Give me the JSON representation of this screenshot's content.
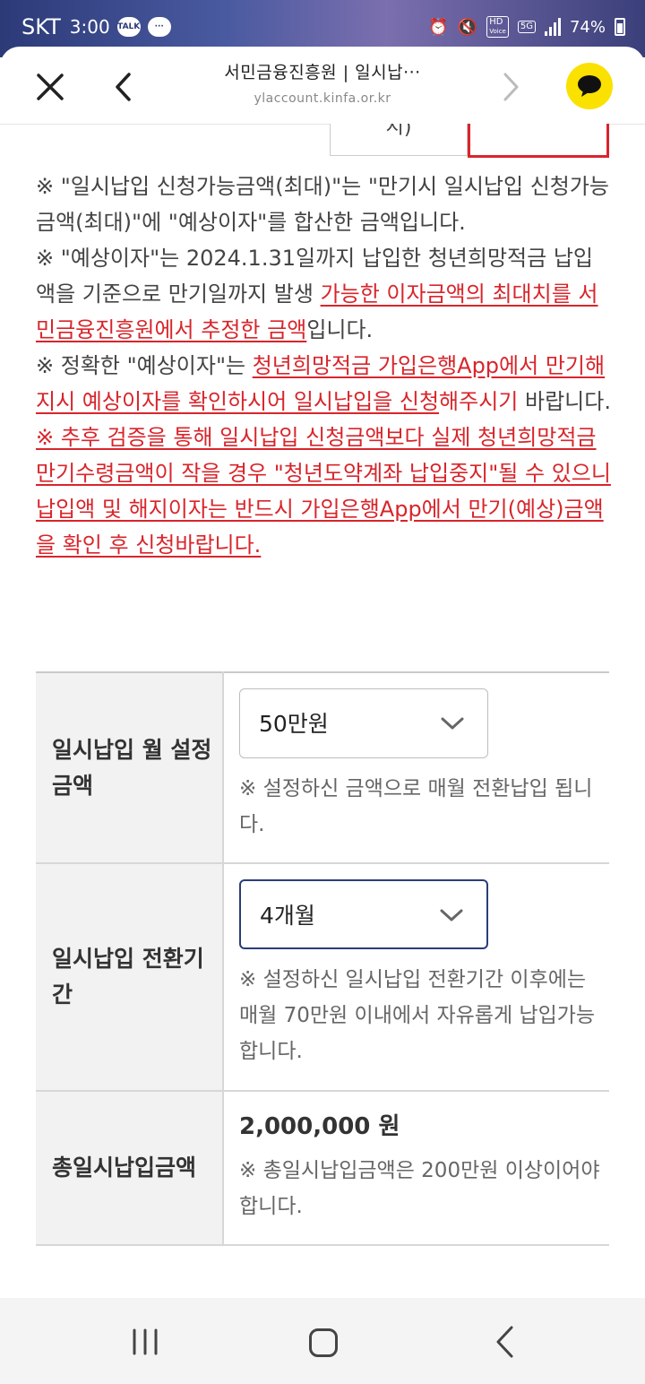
{
  "status_bar": {
    "carrier": "SKT",
    "time": "3:00",
    "talk_badge": "TALK",
    "hd_label": "HD",
    "voice_label": "Voice",
    "network": "5G",
    "battery": "74%"
  },
  "browser": {
    "title": "서민금융진흥원 | 일시납···",
    "url": "ylaccount.kinfa.or.kr"
  },
  "tabs": {
    "partial_label": "시)"
  },
  "notes": {
    "n1": "※ \"일시납입 신청가능금액(최대)\"는 \"만기시 일시납입 신청가능금액(최대)\"에 \"예상이자\"를 합산한 금액입니다.",
    "n2_a": "※ \"예상이자\"는 2024.1.31일까지 납입한 청년희망적금 납입액을 기준으로 만기일까지 발생 ",
    "n2_red": "가능한 이자금액의 최대치를 서민금융진흥원에서 추정한 금액",
    "n2_b": "입니다.",
    "n3_a": "※ 정확한 \"예상이자\"는 ",
    "n3_red": "청년희망적금 가입은행App에서 만기해지시 예상이자를 확인하시어 일시납입을 신청",
    "n3_redplain": "해주시기",
    "n3_b": " 바랍니다.",
    "n4": "※ 추후 검증을 통해 일시납입 신청금액보다 실제 청년희망적금 만기수령금액이 작을 경우 \"청년도약계좌 납입중지\"될 수 있으니 납입액 및 해지이자는 반드시 가입은행App에서 만기(예상)금액을 확인 후 신청바랍니다."
  },
  "form": {
    "monthly": {
      "label": "일시납입 월 설정금액",
      "selected": "50만원",
      "desc": "※ 설정하신 금액으로 매월 전환납입 됩니다."
    },
    "period": {
      "label": "일시납입 전환기간",
      "selected": "4개월",
      "desc": "※ 설정하신 일시납입 전환기간 이후에는 매월 70만원 이내에서 자유롭게 납입가능합니다."
    },
    "total": {
      "label": "총일시납입금액",
      "amount": "2,000,000 원",
      "desc": "※ 총일시납입금액은 200만원 이상이어야합니다."
    }
  },
  "colors": {
    "accent_red": "#d8252b",
    "focus_navy": "#2a3d78",
    "kakao_yellow": "#fae100"
  }
}
